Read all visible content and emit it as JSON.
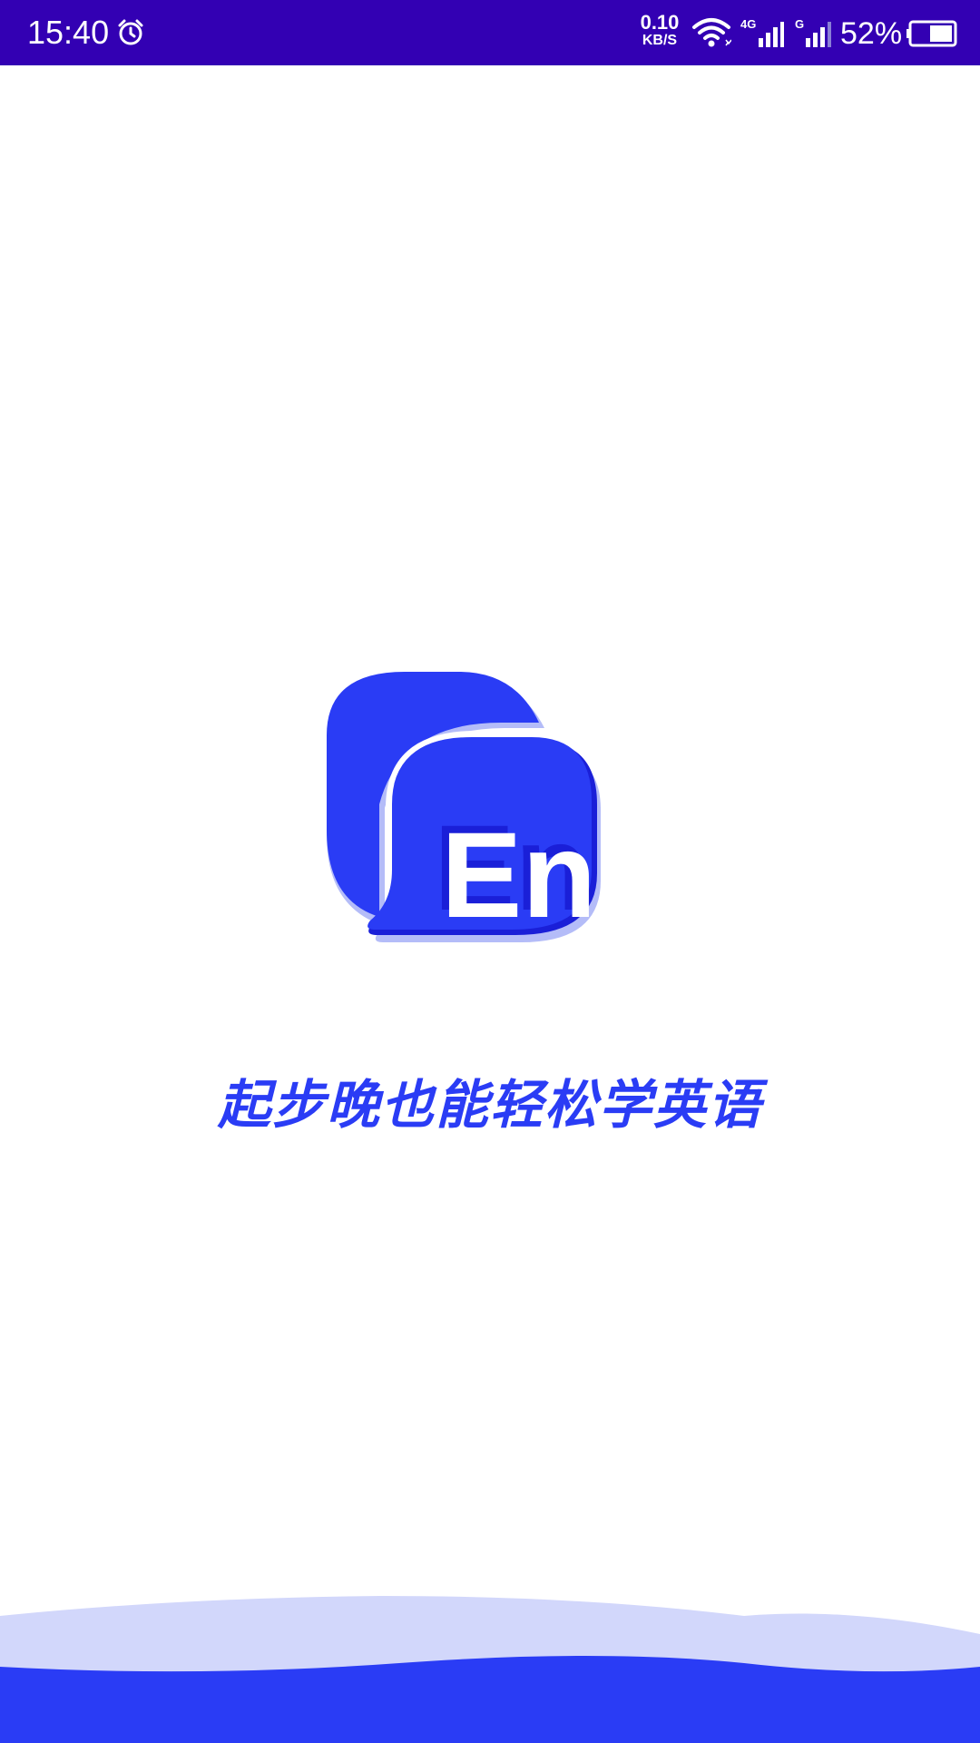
{
  "status_bar": {
    "time": "15:40",
    "net_speed_value": "0.10",
    "net_speed_unit": "KB/S",
    "signal1_label": "4G",
    "signal2_label": "G",
    "battery_percent": "52%"
  },
  "splash": {
    "logo_text": "En",
    "tagline": "起步晚也能轻松学英语"
  },
  "colors": {
    "status_bar_bg": "#3300b3",
    "brand_blue": "#2a3cf5",
    "light_blue": "#d2d7fb"
  },
  "icons": {
    "alarm": "alarm-clock-icon",
    "wifi": "wifi-icon",
    "cell_signal": "cell-signal-icon",
    "battery": "battery-icon",
    "logo": "speech-bubble-logo"
  }
}
